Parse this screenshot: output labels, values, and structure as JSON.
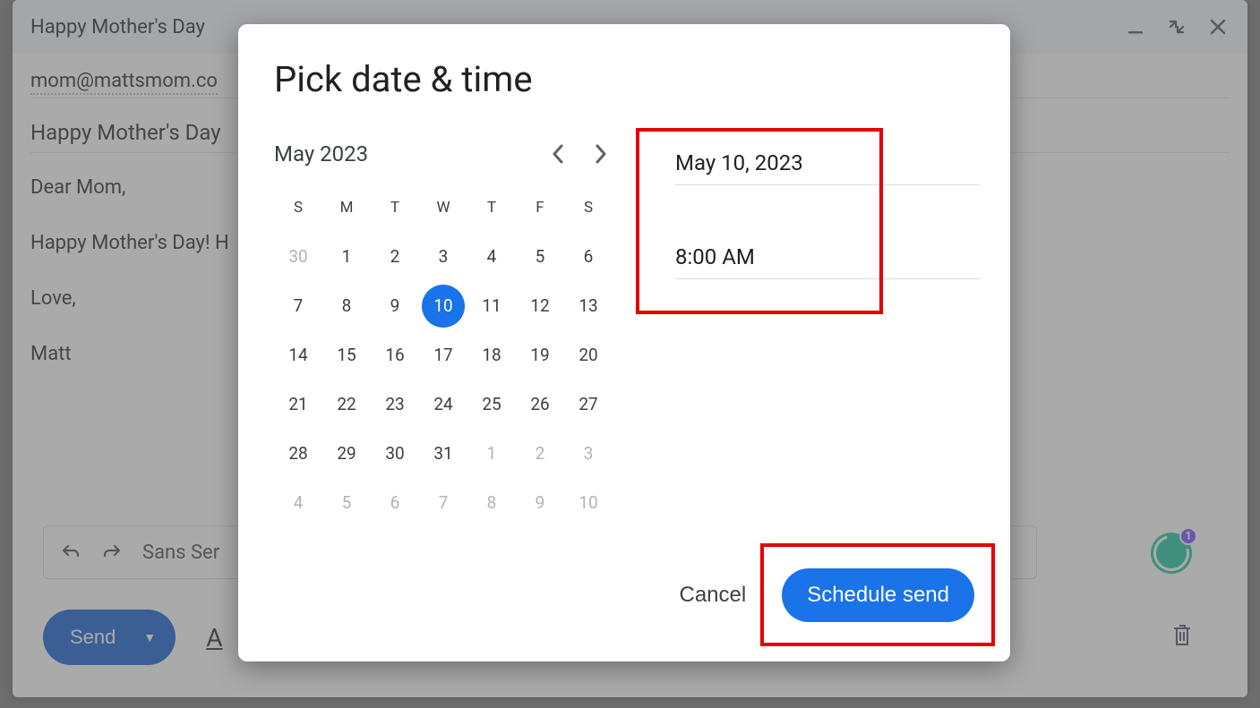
{
  "compose": {
    "title": "Happy Mother's Day",
    "to": "mom@mattsmom.co",
    "subject": "Happy Mother's Day",
    "body_lines": [
      "Dear Mom,",
      "Happy Mother's Day! H",
      "Love,",
      "Matt"
    ],
    "send_label": "Send",
    "font_label": "Sans Ser",
    "attach_label": "A",
    "grammarly_badge": "1"
  },
  "modal": {
    "title": "Pick date & time",
    "month_label": "May 2023",
    "dow": [
      "S",
      "M",
      "T",
      "W",
      "T",
      "F",
      "S"
    ],
    "weeks": [
      [
        {
          "n": "30",
          "o": true
        },
        {
          "n": "1"
        },
        {
          "n": "2"
        },
        {
          "n": "3"
        },
        {
          "n": "4"
        },
        {
          "n": "5"
        },
        {
          "n": "6"
        }
      ],
      [
        {
          "n": "7"
        },
        {
          "n": "8"
        },
        {
          "n": "9"
        },
        {
          "n": "10",
          "sel": true
        },
        {
          "n": "11"
        },
        {
          "n": "12"
        },
        {
          "n": "13"
        }
      ],
      [
        {
          "n": "14"
        },
        {
          "n": "15"
        },
        {
          "n": "16"
        },
        {
          "n": "17"
        },
        {
          "n": "18"
        },
        {
          "n": "19"
        },
        {
          "n": "20"
        }
      ],
      [
        {
          "n": "21"
        },
        {
          "n": "22"
        },
        {
          "n": "23"
        },
        {
          "n": "24"
        },
        {
          "n": "25"
        },
        {
          "n": "26"
        },
        {
          "n": "27"
        }
      ],
      [
        {
          "n": "28"
        },
        {
          "n": "29"
        },
        {
          "n": "30"
        },
        {
          "n": "31"
        },
        {
          "n": "1",
          "o": true
        },
        {
          "n": "2",
          "o": true
        },
        {
          "n": "3",
          "o": true
        }
      ],
      [
        {
          "n": "4",
          "o": true
        },
        {
          "n": "5",
          "o": true
        },
        {
          "n": "6",
          "o": true
        },
        {
          "n": "7",
          "o": true
        },
        {
          "n": "8",
          "o": true
        },
        {
          "n": "9",
          "o": true
        },
        {
          "n": "10",
          "o": true
        }
      ]
    ],
    "date_field": "May 10, 2023",
    "time_field": "8:00 AM",
    "cancel_label": "Cancel",
    "schedule_label": "Schedule send"
  }
}
